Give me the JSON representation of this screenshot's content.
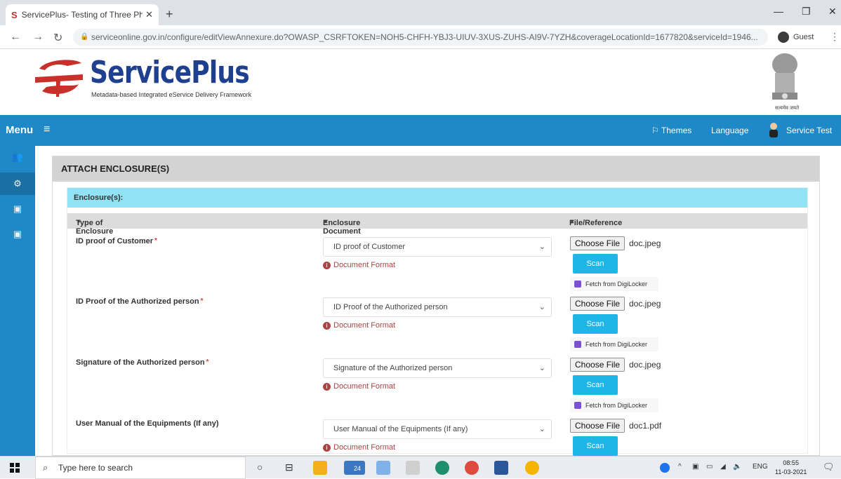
{
  "browser": {
    "tab_title": "ServicePlus- Testing of Three Ph...",
    "tab_close": "✕",
    "new_tab": "+",
    "url": "serviceonline.gov.in/configure/editViewAnnexure.do?OWASP_CSRFTOKEN=NOH5-CHFH-YBJ3-UIUV-3XUS-ZUHS-AI9V-7YZH&coverageLocationId=1677820&serviceId=1946...",
    "profile_label": "Guest"
  },
  "header": {
    "brand": "ServicePlus",
    "tagline": "Metadata-based Integrated eService Delivery Framework",
    "emblem_caption": "सत्यमेव जयते"
  },
  "topnav": {
    "menu_label": "Menu",
    "themes": "Themes",
    "language": "Language",
    "user": "Service Test"
  },
  "panel": {
    "title": "ATTACH ENCLOSURE(S)",
    "section_title": "Enclosure(s):",
    "columns": {
      "type": "Type of Enclosure",
      "document": "Enclosure Document",
      "file": "File/Reference"
    }
  },
  "common": {
    "document_format": "Document Format",
    "choose_file": "Choose File",
    "scan": "Scan",
    "digilocker": "Fetch from DigiLocker"
  },
  "enclosures": [
    {
      "label": "ID proof of Customer",
      "required": true,
      "selected": "ID proof of Customer",
      "file": "doc.jpeg"
    },
    {
      "label": "ID Proof of the Authorized person",
      "required": true,
      "selected": "ID Proof of the Authorized person",
      "file": "doc.jpeg"
    },
    {
      "label": "Signature of the Authorized person",
      "required": true,
      "selected": "Signature of the Authorized person",
      "file": "doc.jpeg"
    },
    {
      "label": "User Manual of the Equipments (If any)",
      "required": false,
      "selected": "User Manual of the Equipments (If any)",
      "file": "doc1.pdf"
    }
  ],
  "taskbar": {
    "search_placeholder": "Type here to search",
    "mail_badge": "24",
    "lang": "ENG",
    "time": "08:55",
    "date": "11-03-2021"
  },
  "colors": {
    "nav_blue": "#1f88c6",
    "section_cyan": "#91e2f2",
    "scan_button": "#1fb5e6",
    "brand_blue": "#1f3f8f",
    "error_red": "#a94442"
  }
}
